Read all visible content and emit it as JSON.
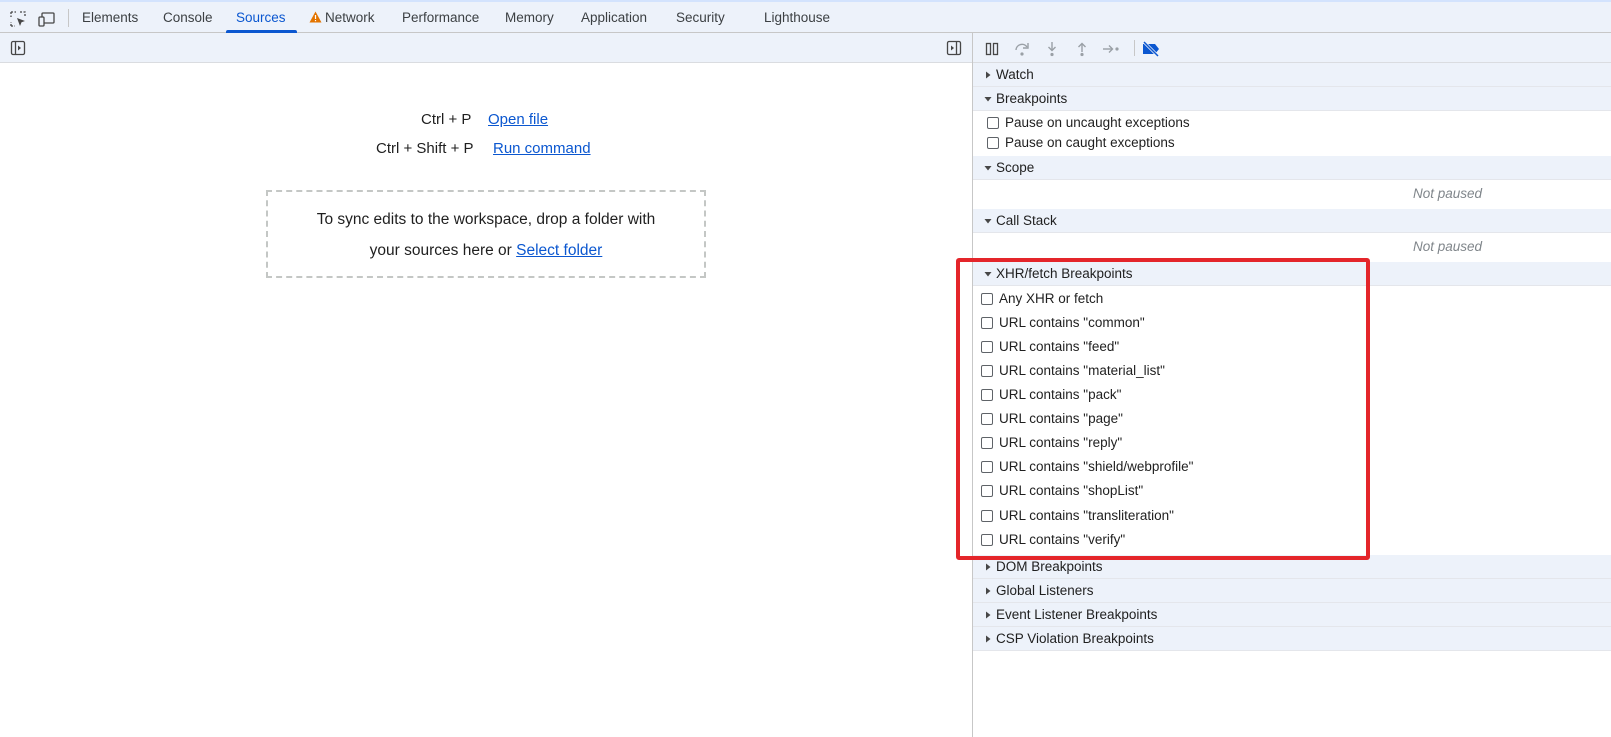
{
  "topbar": {
    "icons": [
      "inspect-element-icon",
      "device-toolbar-icon"
    ],
    "tabs": [
      {
        "label": "Elements"
      },
      {
        "label": "Console"
      },
      {
        "label": "Sources"
      },
      {
        "label": "Network"
      },
      {
        "label": "Performance"
      },
      {
        "label": "Memory"
      },
      {
        "label": "Application"
      },
      {
        "label": "Security"
      },
      {
        "label": "Lighthouse"
      }
    ],
    "active_tab": "Sources",
    "warning_tab": "Network",
    "accent_color": "#0b57d0",
    "warning_color": "#e37400"
  },
  "editor": {
    "shortcuts": [
      {
        "keys": "Ctrl + P",
        "action": "Open file"
      },
      {
        "keys": "Ctrl + Shift + P",
        "action": "Run command"
      }
    ],
    "dropzone": {
      "text_line1": "To sync edits to the workspace, drop a folder with",
      "text_line2": "your sources here or",
      "link": "Select folder"
    }
  },
  "debugger": {
    "toolbar_icons": [
      "pause-resume-icon",
      "step-over-icon",
      "step-into-icon",
      "step-out-icon",
      "step-icon",
      "deactivate-breakpoints-icon"
    ],
    "sections": {
      "watch": "Watch",
      "breakpoints": "Breakpoints",
      "scope": "Scope",
      "call_stack": "Call Stack",
      "xhr": "XHR/fetch Breakpoints",
      "dom": "DOM Breakpoints",
      "global": "Global Listeners",
      "event": "Event Listener Breakpoints",
      "csp": "CSP Violation Breakpoints"
    },
    "breakpoint_options": [
      "Pause on uncaught exceptions",
      "Pause on caught exceptions"
    ],
    "scope_status": "Not paused",
    "call_stack_status": "Not paused",
    "xhr_items": [
      "Any XHR or fetch",
      "URL contains \"common\"",
      "URL contains \"feed\"",
      "URL contains \"material_list\"",
      "URL contains \"pack\"",
      "URL contains \"page\"",
      "URL contains \"reply\"",
      "URL contains \"shield/webprofile\"",
      "URL contains \"shopList\"",
      "URL contains \"transliteration\"",
      "URL contains \"verify\""
    ],
    "highlight_color": "#e4252a"
  }
}
